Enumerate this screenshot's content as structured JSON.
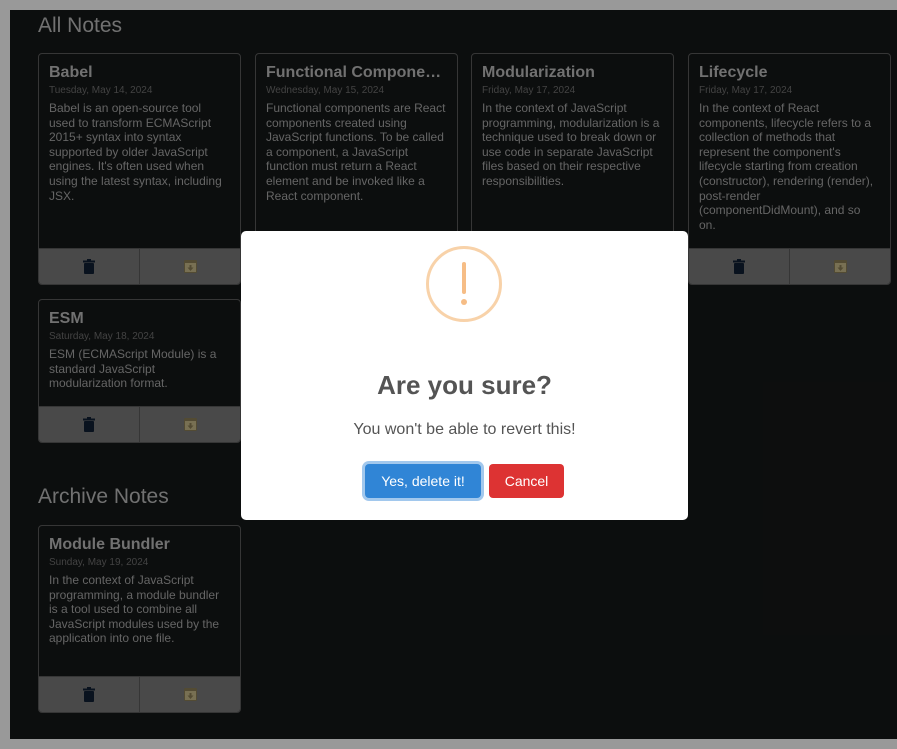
{
  "sections": {
    "all_notes_title": "All Notes",
    "archive_notes_title": "Archive Notes"
  },
  "notes": [
    {
      "title": "Babel",
      "date": "Tuesday, May 14, 2024",
      "body": "Babel is an open-source tool used to transform ECMAScript 2015+ syntax into syntax supported by older JavaScript engines. It's often used when using the latest syntax, including JSX."
    },
    {
      "title": "Functional Components",
      "date": "Wednesday, May 15, 2024",
      "body": "Functional components are React components created using JavaScript functions. To be called a component, a JavaScript function must return a React element and be invoked like a React component."
    },
    {
      "title": "Modularization",
      "date": "Friday, May 17, 2024",
      "body": "In the context of JavaScript programming, modularization is a technique used to break down or use code in separate JavaScript files based on their respective responsibilities."
    },
    {
      "title": "Lifecycle",
      "date": "Friday, May 17, 2024",
      "body": "In the context of React components, lifecycle refers to a collection of methods that represent the component's lifecycle starting from creation (constructor), rendering (render), post-render (componentDidMount), and so on."
    },
    {
      "title": "ESM",
      "date": "Saturday, May 18, 2024",
      "body": "ESM (ECMAScript Module) is a standard JavaScript modularization format."
    }
  ],
  "archived_notes": [
    {
      "title": "Module Bundler",
      "date": "Sunday, May 19, 2024",
      "body": "In the context of JavaScript programming, a module bundler is a tool used to combine all JavaScript modules used by the application into one file."
    }
  ],
  "icons": {
    "delete": "trash-icon",
    "archive": "archive-box-icon",
    "warning": "warning-exclamation-icon"
  },
  "colors": {
    "background": "#151818",
    "card_border": "#5b5b5b",
    "action_bar": "#7a7a7a",
    "trash_icon": "#0f1e33",
    "archive_icon": "#8a7e55",
    "confirm_button": "#3085d6",
    "cancel_button": "#dd3333",
    "warning_icon": "#f8bb86"
  },
  "modal": {
    "title": "Are you sure?",
    "text": "You won't be able to revert this!",
    "confirm_label": "Yes, delete it!",
    "cancel_label": "Cancel"
  }
}
